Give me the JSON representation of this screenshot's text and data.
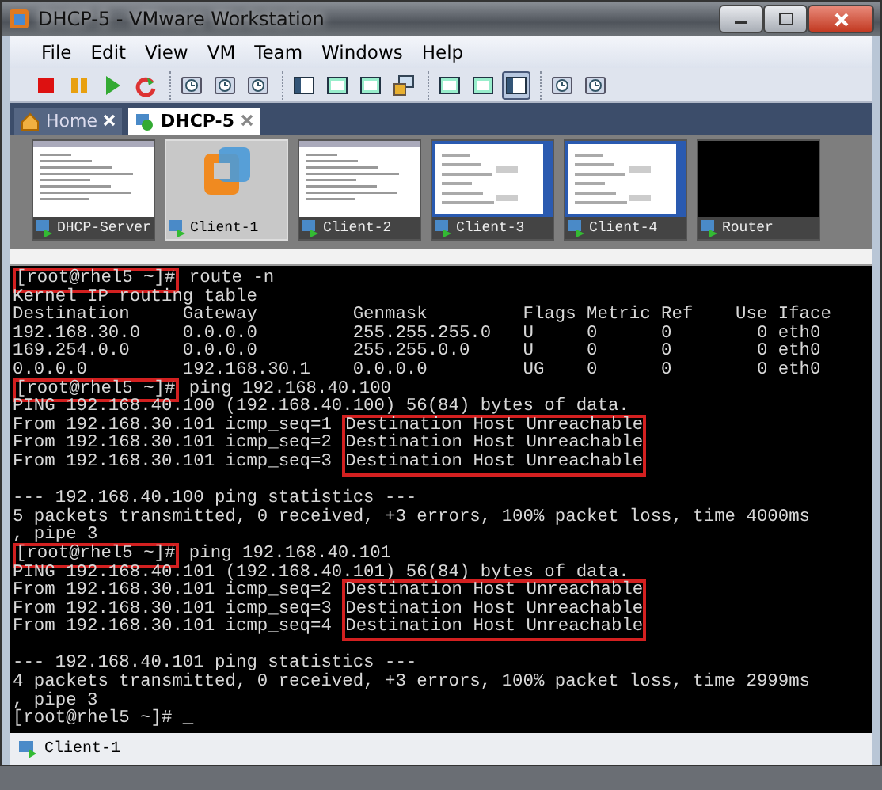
{
  "window": {
    "title": "DHCP-5 - VMware Workstation"
  },
  "menu": [
    "File",
    "Edit",
    "View",
    "VM",
    "Team",
    "Windows",
    "Help"
  ],
  "toolbar": {
    "groups": [
      [
        {
          "kind": "stop",
          "pressed": false
        },
        {
          "kind": "pause",
          "pressed": false
        },
        {
          "kind": "play",
          "pressed": false
        },
        {
          "kind": "reset",
          "pressed": false
        }
      ],
      [
        {
          "kind": "clock",
          "pressed": false
        },
        {
          "kind": "clock",
          "pressed": false
        },
        {
          "kind": "clock",
          "pressed": false
        }
      ],
      [
        {
          "kind": "panel",
          "pressed": false
        },
        {
          "kind": "screen",
          "pressed": false
        },
        {
          "kind": "screen",
          "pressed": false
        },
        {
          "kind": "windows",
          "pressed": false
        }
      ],
      [
        {
          "kind": "screen",
          "pressed": false
        },
        {
          "kind": "screen",
          "pressed": false
        },
        {
          "kind": "panel",
          "pressed": true
        }
      ],
      [
        {
          "kind": "clock",
          "pressed": false
        },
        {
          "kind": "clock",
          "pressed": false
        }
      ]
    ]
  },
  "tabs": [
    {
      "label": "Home",
      "kind": "home",
      "selected": false
    },
    {
      "label": "DHCP-5",
      "kind": "vm",
      "selected": true
    }
  ],
  "thumbnails": [
    {
      "label": "DHCP-Server",
      "kind": "console",
      "selected": false
    },
    {
      "label": "Client-1",
      "kind": "logo",
      "selected": true
    },
    {
      "label": "Client-2",
      "kind": "console",
      "selected": false
    },
    {
      "label": "Client-3",
      "kind": "desktop",
      "selected": false
    },
    {
      "label": "Client-4",
      "kind": "desktop",
      "selected": false
    },
    {
      "label": "Router",
      "kind": "blank",
      "selected": false
    }
  ],
  "terminal": {
    "lines": [
      {
        "kind": "text",
        "segments": [
          {
            "text": "[root@rhel5 ~]#",
            "boxed": true
          },
          {
            "text": " route -n",
            "boxed": false
          }
        ]
      },
      {
        "kind": "text",
        "segments": [
          {
            "text": "Kernel IP routing table",
            "boxed": false
          }
        ]
      },
      {
        "kind": "text",
        "segments": [
          {
            "text": "Destination     Gateway         Genmask         Flags Metric Ref    Use Iface",
            "boxed": false
          }
        ]
      },
      {
        "kind": "text",
        "segments": [
          {
            "text": "192.168.30.0    0.0.0.0         255.255.255.0   U     0      0        0 eth0",
            "boxed": false
          }
        ]
      },
      {
        "kind": "text",
        "segments": [
          {
            "text": "169.254.0.0     0.0.0.0         255.255.0.0     U     0      0        0 eth0",
            "boxed": false
          }
        ]
      },
      {
        "kind": "text",
        "segments": [
          {
            "text": "0.0.0.0         192.168.30.1    0.0.0.0         UG    0      0        0 eth0",
            "boxed": false
          }
        ]
      },
      {
        "kind": "text",
        "segments": [
          {
            "text": "[root@rhel5 ~]#",
            "boxed": true
          },
          {
            "text": " ping 192.168.40.100",
            "boxed": false
          }
        ]
      },
      {
        "kind": "text",
        "segments": [
          {
            "text": "PING 192.168.40.100 (192.168.40.100) 56(84) bytes of data.",
            "boxed": false
          }
        ]
      },
      {
        "kind": "text",
        "segments": [
          {
            "text": "From 192.168.30.101 icmp_seq=1 ",
            "boxed": false
          },
          {
            "text": "Destination Host Unreachable",
            "boxed": true
          }
        ]
      },
      {
        "kind": "text",
        "segments": [
          {
            "text": "From 192.168.30.101 icmp_seq=2 ",
            "boxed": false
          },
          {
            "text": "Destination Host Unreachable",
            "boxed": true
          }
        ]
      },
      {
        "kind": "text",
        "segments": [
          {
            "text": "From 192.168.30.101 icmp_seq=3 ",
            "boxed": false
          },
          {
            "text": "Destination Host Unreachable",
            "boxed": true
          }
        ]
      },
      {
        "kind": "blank"
      },
      {
        "kind": "text",
        "segments": [
          {
            "text": "--- 192.168.40.100 ping statistics ---",
            "boxed": false
          }
        ]
      },
      {
        "kind": "text",
        "segments": [
          {
            "text": "5 packets transmitted, 0 received, +3 errors, 100% packet loss, time 4000ms",
            "boxed": false
          }
        ]
      },
      {
        "kind": "text",
        "segments": [
          {
            "text": ", pipe 3",
            "boxed": false
          }
        ]
      },
      {
        "kind": "text",
        "segments": [
          {
            "text": "[root@rhel5 ~]#",
            "boxed": true
          },
          {
            "text": " ping 192.168.40.101",
            "boxed": false
          }
        ]
      },
      {
        "kind": "text",
        "segments": [
          {
            "text": "PING 192.168.40.101 (192.168.40.101) 56(84) bytes of data.",
            "boxed": false
          }
        ]
      },
      {
        "kind": "text",
        "segments": [
          {
            "text": "From 192.168.30.101 icmp_seq=2 ",
            "boxed": false
          },
          {
            "text": "Destination Host Unreachable",
            "boxed": true
          }
        ]
      },
      {
        "kind": "text",
        "segments": [
          {
            "text": "From 192.168.30.101 icmp_seq=3 ",
            "boxed": false
          },
          {
            "text": "Destination Host Unreachable",
            "boxed": true
          }
        ]
      },
      {
        "kind": "text",
        "segments": [
          {
            "text": "From 192.168.30.101 icmp_seq=4 ",
            "boxed": false
          },
          {
            "text": "Destination Host Unreachable",
            "boxed": true
          }
        ]
      },
      {
        "kind": "blank"
      },
      {
        "kind": "text",
        "segments": [
          {
            "text": "--- 192.168.40.101 ping statistics ---",
            "boxed": false
          }
        ]
      },
      {
        "kind": "text",
        "segments": [
          {
            "text": "4 packets transmitted, 0 received, +3 errors, 100% packet loss, time 2999ms",
            "boxed": false
          }
        ]
      },
      {
        "kind": "text",
        "segments": [
          {
            "text": ", pipe 3",
            "boxed": false
          }
        ]
      },
      {
        "kind": "text",
        "segments": [
          {
            "text": "[root@rhel5 ~]# _",
            "boxed": false
          }
        ]
      }
    ]
  },
  "status_bar": {
    "label": "Client-1"
  }
}
